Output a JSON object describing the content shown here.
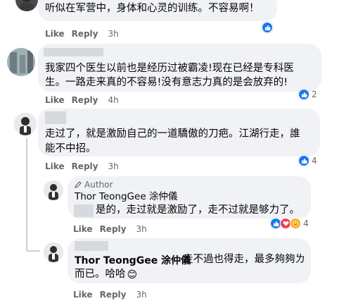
{
  "comments": [
    {
      "text": "听似在军营中，身体和心灵的训练。不容易啊！",
      "like": "Like",
      "reply": "Reply",
      "time": "3h"
    },
    {
      "text_line1": "我家四个医生以前也是经历过被霸凌!现在已经是专科医",
      "text_line2": "生。一路走来真的不容易!没有意志力真的是会放弃的!",
      "like": "Like",
      "reply": "Reply",
      "time": "4h",
      "reactions": "2"
    },
    {
      "text_line1": "走过了，就是激励自己的一道驕傲的刀疤。江湖行走，誰",
      "text_line2": "能不中招。",
      "like": "Like",
      "reply": "Reply",
      "time": "3h",
      "reactions": "4"
    }
  ],
  "replies": [
    {
      "badge": "Author",
      "name": "Thor TeongGee 涂仲儀",
      "text": "是的，走过就是激励了，走不过就是够力了。",
      "like": "Like",
      "reply": "Reply",
      "time": "3h",
      "reactions": "4"
    },
    {
      "name": "Thor TeongGee 涂仲儀",
      "text_part1": "走不過也得走，最多夠夠ㄌ",
      "text_line2": "而已。哈哈",
      "emoji": "😊",
      "like": "Like",
      "reply": "Reply",
      "time": "3h"
    }
  ],
  "colors": {
    "like": "#1877f2",
    "love": "#f33e58",
    "care": "#f7b125",
    "bubble": "#f0f2f5",
    "meta": "#65676b"
  }
}
